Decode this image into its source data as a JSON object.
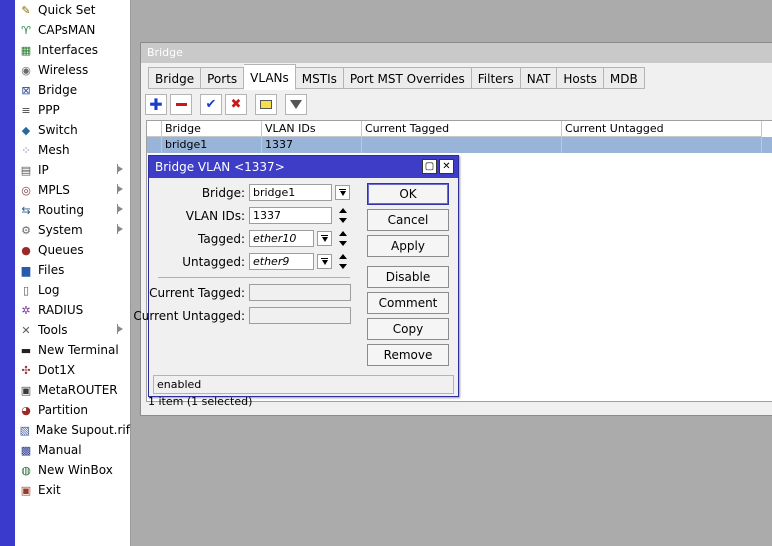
{
  "sidebar": {
    "items": [
      {
        "label": "Quick Set",
        "icon": "wand-icon",
        "glyph": "✎",
        "color": "#8a6a00",
        "submenu": false
      },
      {
        "label": "CAPsMAN",
        "icon": "antenna-icon",
        "glyph": "♈",
        "color": "#1c7a3a",
        "submenu": false
      },
      {
        "label": "Interfaces",
        "icon": "interfaces-icon",
        "glyph": "▦",
        "color": "#2a7a2a",
        "submenu": false
      },
      {
        "label": "Wireless",
        "icon": "wireless-icon",
        "glyph": "◉",
        "color": "#6a6a6a",
        "submenu": false
      },
      {
        "label": "Bridge",
        "icon": "bridge-icon",
        "glyph": "⊠",
        "color": "#2a4a9a",
        "submenu": false
      },
      {
        "label": "PPP",
        "icon": "ppp-icon",
        "glyph": "≡",
        "color": "#444444",
        "submenu": false
      },
      {
        "label": "Switch",
        "icon": "switch-icon",
        "glyph": "◆",
        "color": "#2a6a9a",
        "submenu": false
      },
      {
        "label": "Mesh",
        "icon": "mesh-icon",
        "glyph": "⁘",
        "color": "#3a5a9a",
        "submenu": false
      },
      {
        "label": "IP",
        "icon": "ip-icon",
        "glyph": "▤",
        "color": "#555555",
        "submenu": true
      },
      {
        "label": "MPLS",
        "icon": "mpls-icon",
        "glyph": "◎",
        "color": "#7a3a3a",
        "submenu": true
      },
      {
        "label": "Routing",
        "icon": "routing-icon",
        "glyph": "⇆",
        "color": "#2a5a8a",
        "submenu": true
      },
      {
        "label": "System",
        "icon": "system-icon",
        "glyph": "⚙",
        "color": "#6a6a6a",
        "submenu": true
      },
      {
        "label": "Queues",
        "icon": "queues-icon",
        "glyph": "●",
        "color": "#9a2a2a",
        "submenu": false
      },
      {
        "label": "Files",
        "icon": "files-icon",
        "glyph": "▆",
        "color": "#2a5aaa",
        "submenu": false
      },
      {
        "label": "Log",
        "icon": "log-icon",
        "glyph": "▯",
        "color": "#555555",
        "submenu": false
      },
      {
        "label": "RADIUS",
        "icon": "radius-icon",
        "glyph": "✲",
        "color": "#7a3a9a",
        "submenu": false
      },
      {
        "label": "Tools",
        "icon": "tools-icon",
        "glyph": "✕",
        "color": "#5a5a5a",
        "submenu": true
      },
      {
        "label": "New Terminal",
        "icon": "terminal-icon",
        "glyph": "▬",
        "color": "#222222",
        "submenu": false
      },
      {
        "label": "Dot1X",
        "icon": "dot1x-icon",
        "glyph": "✣",
        "color": "#9a3a3a",
        "submenu": false
      },
      {
        "label": "MetaROUTER",
        "icon": "metarouter-icon",
        "glyph": "▣",
        "color": "#3a3a3a",
        "submenu": false
      },
      {
        "label": "Partition",
        "icon": "partition-icon",
        "glyph": "◕",
        "color": "#9a2a2a",
        "submenu": false
      },
      {
        "label": "Make Supout.rif",
        "icon": "supout-icon",
        "glyph": "▧",
        "color": "#3a5a9a",
        "submenu": false
      },
      {
        "label": "Manual",
        "icon": "manual-icon",
        "glyph": "▩",
        "color": "#2a3a8a",
        "submenu": false
      },
      {
        "label": "New WinBox",
        "icon": "winbox-icon",
        "glyph": "◍",
        "color": "#2a6a3a",
        "submenu": false
      },
      {
        "label": "Exit",
        "icon": "exit-icon",
        "glyph": "▣",
        "color": "#9a3a2a",
        "submenu": false
      }
    ]
  },
  "bridge_window": {
    "title": "Bridge",
    "tabs": [
      "Bridge",
      "Ports",
      "VLANs",
      "MSTIs",
      "Port MST Overrides",
      "Filters",
      "NAT",
      "Hosts",
      "MDB"
    ],
    "active_tab": "VLANs",
    "columns": [
      "Bridge",
      "VLAN IDs",
      "Current Tagged",
      "Current Untagged"
    ],
    "rows": [
      {
        "cells": [
          "bridge1",
          "1337",
          "",
          ""
        ],
        "selected": true
      }
    ],
    "status": "1 item (1 selected)"
  },
  "dialog": {
    "title": "Bridge VLAN <1337>",
    "fields": {
      "bridge": {
        "label": "Bridge:",
        "value": "bridge1"
      },
      "vlan_ids": {
        "label": "VLAN IDs:",
        "value": "1337"
      },
      "tagged": {
        "label": "Tagged:",
        "value": "ether10"
      },
      "untagged": {
        "label": "Untagged:",
        "value": "ether9"
      },
      "current_tagged": {
        "label": "Current Tagged:",
        "value": ""
      },
      "current_untagged": {
        "label": "Current Untagged:",
        "value": ""
      }
    },
    "buttons": [
      "OK",
      "Cancel",
      "Apply",
      "Disable",
      "Comment",
      "Copy",
      "Remove"
    ],
    "status": "enabled"
  },
  "colors": {
    "accent_blue": "#3d3dc8",
    "selection": "#99b4d9",
    "desktop": "#ababab"
  }
}
